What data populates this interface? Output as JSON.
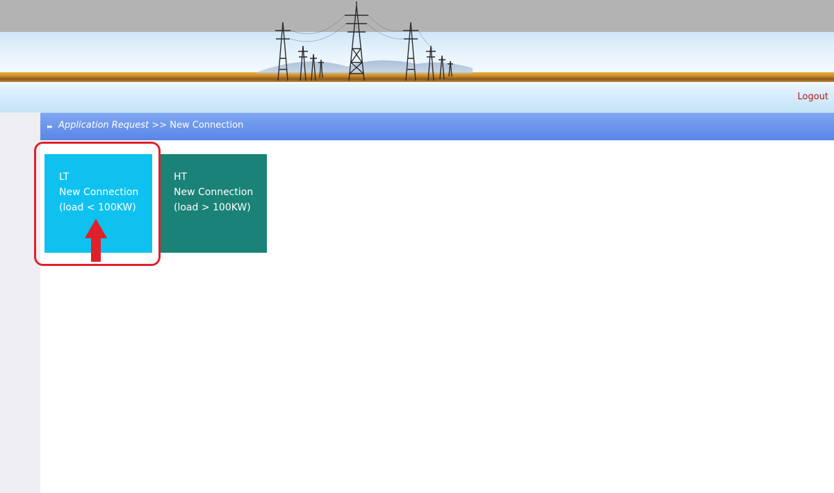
{
  "header": {
    "logout_label": "Logout"
  },
  "breadcrumb": {
    "parent": "Application Request",
    "separator": ">>",
    "current": "New Connection"
  },
  "tiles": [
    {
      "line1": "LT",
      "line2": "New Connection",
      "line3": "(load < 100KW)",
      "color": "#0ec1ef"
    },
    {
      "line1": "HT",
      "line2": "New Connection",
      "line3": "(load > 100KW)",
      "color": "#1a8276"
    }
  ],
  "annotation": {
    "highlight_color": "#e0202a",
    "arrow_icon": "red-up-arrow-icon"
  }
}
